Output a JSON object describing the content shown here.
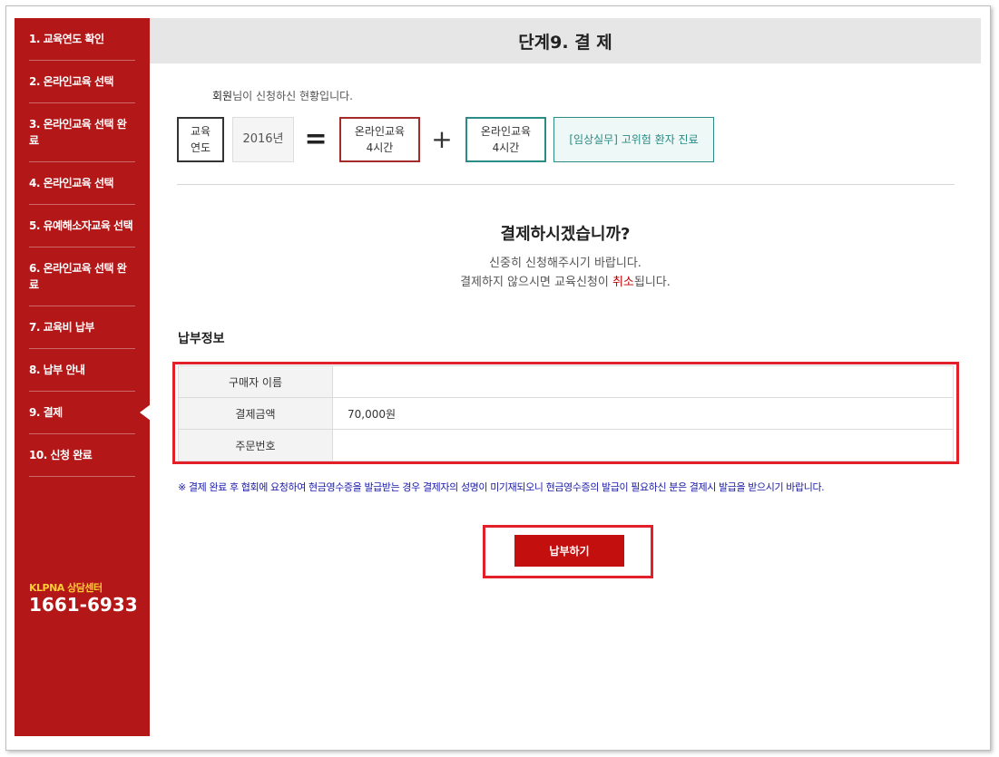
{
  "sidebar": {
    "items": [
      {
        "label": "1. 교육연도 확인"
      },
      {
        "label": "2. 온라인교육 선택"
      },
      {
        "label": "3. 온라인교육 선택 완료"
      },
      {
        "label": "4. 온라인교육 선택"
      },
      {
        "label": "5. 유예해소자교육 선택"
      },
      {
        "label": "6. 온라인교육 선택 완료"
      },
      {
        "label": "7. 교육비 납부"
      },
      {
        "label": "8. 납부 안내"
      },
      {
        "label": "9. 결제"
      },
      {
        "label": "10. 신청 완료"
      }
    ],
    "active_index": 8,
    "support_label": "KLPNA 상담센터",
    "support_phone": "1661-6933"
  },
  "header": {
    "title": "단계9. 결 제"
  },
  "greeting": {
    "name": "회원",
    "text": "님이 신청하신 현황입니다."
  },
  "status": {
    "year_label_line1": "교육",
    "year_label_line2": "연도",
    "year_value": "2016년",
    "equals": "=",
    "online_total_line1": "온라인교육",
    "online_total_line2": "4시간",
    "plus": "+",
    "online_item_line1": "온라인교육",
    "online_item_line2": "4시간",
    "course_name": "[임상실무] 고위험 환자 진료"
  },
  "confirm": {
    "title": "결제하시겠습니까?",
    "line1": "신중히 신청해주시기 바랍니다.",
    "line2_pre": "결제하지 않으시면 교육신청이 ",
    "line2_highlight": "취소",
    "line2_post": "됩니다."
  },
  "payment": {
    "section_title": "납부정보",
    "rows": [
      {
        "label": "구매자 이름",
        "value": ""
      },
      {
        "label": "결제금액",
        "value": "70,000원"
      },
      {
        "label": "주문번호",
        "value": ""
      }
    ]
  },
  "notice": "※ 결제 완료 후 협회에 요청하여 현금영수증을 발급받는 경우 결제자의 성명이 미기재되오니 현금영수증의 발급이 필요하신 분은 결제시 발급을 받으시기 바랍니다.",
  "pay_button": {
    "label": "납부하기"
  },
  "colors": {
    "sidebar_bg": "#b31717",
    "accent_red": "#c40f0f",
    "teal": "#2a8c86",
    "highlight_outline": "#e3202a"
  }
}
